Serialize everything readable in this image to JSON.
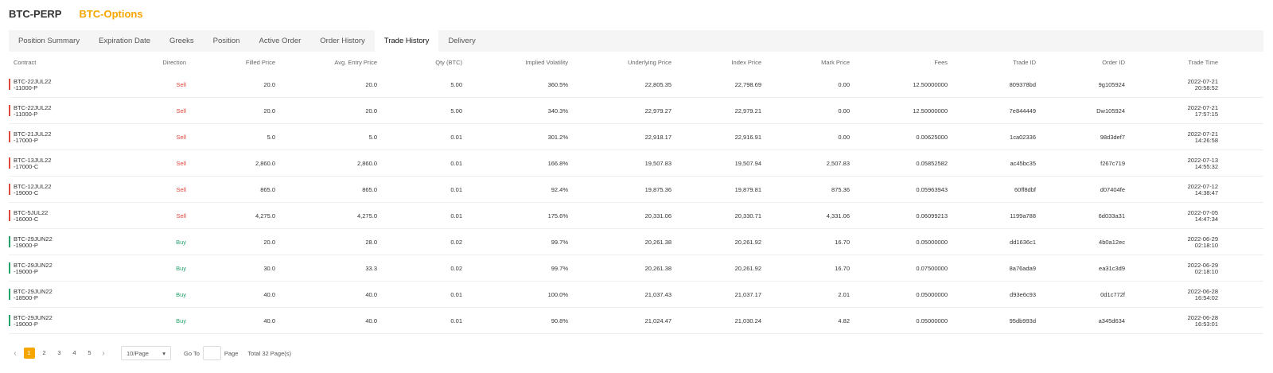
{
  "top_tabs": [
    {
      "label": "BTC-PERP",
      "active": false
    },
    {
      "label": "BTC-Options",
      "active": true
    }
  ],
  "sub_tabs": [
    {
      "label": "Position Summary",
      "active": false
    },
    {
      "label": "Expiration Date",
      "active": false
    },
    {
      "label": "Greeks",
      "active": false
    },
    {
      "label": "Position",
      "active": false
    },
    {
      "label": "Active Order",
      "active": false
    },
    {
      "label": "Order History",
      "active": false
    },
    {
      "label": "Trade History",
      "active": true
    },
    {
      "label": "Delivery",
      "active": false
    }
  ],
  "columns": [
    "Contract",
    "Direction",
    "Filled Price",
    "Avg. Entry Price",
    "Qty (BTC)",
    "Implied Volatility",
    "Underlying Price",
    "Index Price",
    "Mark Price",
    "Fees",
    "Trade ID",
    "Order ID",
    "Trade Time"
  ],
  "rows": [
    {
      "contract1": "BTC-22JUL22",
      "contract2": "-11000-P",
      "direction": "Sell",
      "filled": "20.0",
      "avg": "20.0",
      "qty": "5.00",
      "iv": "360.5%",
      "underlying": "22,805.35",
      "index": "22,798.69",
      "mark": "0.00",
      "fees": "12.50000000",
      "trade_id": "809378bd",
      "order_id": "9g105924",
      "date": "2022-07-21",
      "time": "20:58:52"
    },
    {
      "contract1": "BTC-22JUL22",
      "contract2": "-11000-P",
      "direction": "Sell",
      "filled": "20.0",
      "avg": "20.0",
      "qty": "5.00",
      "iv": "340.3%",
      "underlying": "22,979.27",
      "index": "22,979.21",
      "mark": "0.00",
      "fees": "12.50000000",
      "trade_id": "7e844449",
      "order_id": "Dw105924",
      "date": "2022-07-21",
      "time": "17:57:15"
    },
    {
      "contract1": "BTC-21JUL22",
      "contract2": "-17000-P",
      "direction": "Sell",
      "filled": "5.0",
      "avg": "5.0",
      "qty": "0.01",
      "iv": "301.2%",
      "underlying": "22,918.17",
      "index": "22,916.91",
      "mark": "0.00",
      "fees": "0.00625000",
      "trade_id": "1ca02336",
      "order_id": "98d3def7",
      "date": "2022-07-21",
      "time": "14:26:58"
    },
    {
      "contract1": "BTC-13JUL22",
      "contract2": "-17000-C",
      "direction": "Sell",
      "filled": "2,860.0",
      "avg": "2,860.0",
      "qty": "0.01",
      "iv": "166.8%",
      "underlying": "19,507.83",
      "index": "19,507.94",
      "mark": "2,507.83",
      "fees": "0.05852582",
      "trade_id": "ac45bc35",
      "order_id": "f267c719",
      "date": "2022-07-13",
      "time": "14:55:32"
    },
    {
      "contract1": "BTC-12JUL22",
      "contract2": "-19000-C",
      "direction": "Sell",
      "filled": "865.0",
      "avg": "865.0",
      "qty": "0.01",
      "iv": "92.4%",
      "underlying": "19,875.36",
      "index": "19,879.81",
      "mark": "875.36",
      "fees": "0.05963943",
      "trade_id": "60ff8dbf",
      "order_id": "d07404fe",
      "date": "2022-07-12",
      "time": "14:38:47"
    },
    {
      "contract1": "BTC-5JUL22",
      "contract2": "-16000-C",
      "direction": "Sell",
      "filled": "4,275.0",
      "avg": "4,275.0",
      "qty": "0.01",
      "iv": "175.6%",
      "underlying": "20,331.06",
      "index": "20,330.71",
      "mark": "4,331.06",
      "fees": "0.06099213",
      "trade_id": "1199a788",
      "order_id": "6d033a31",
      "date": "2022-07-05",
      "time": "14:47:34"
    },
    {
      "contract1": "BTC-29JUN22",
      "contract2": "-19000-P",
      "direction": "Buy",
      "filled": "20.0",
      "avg": "28.0",
      "qty": "0.02",
      "iv": "99.7%",
      "underlying": "20,261.38",
      "index": "20,261.92",
      "mark": "16.70",
      "fees": "0.05000000",
      "trade_id": "dd1636c1",
      "order_id": "4b0a12ec",
      "date": "2022-06-29",
      "time": "02:18:10"
    },
    {
      "contract1": "BTC-29JUN22",
      "contract2": "-19000-P",
      "direction": "Buy",
      "filled": "30.0",
      "avg": "33.3",
      "qty": "0.02",
      "iv": "99.7%",
      "underlying": "20,261.38",
      "index": "20,261.92",
      "mark": "16.70",
      "fees": "0.07500000",
      "trade_id": "8a76ada9",
      "order_id": "ea31c3d9",
      "date": "2022-06-29",
      "time": "02:18:10"
    },
    {
      "contract1": "BTC-29JUN22",
      "contract2": "-18500-P",
      "direction": "Buy",
      "filled": "40.0",
      "avg": "40.0",
      "qty": "0.01",
      "iv": "100.0%",
      "underlying": "21,037.43",
      "index": "21,037.17",
      "mark": "2.01",
      "fees": "0.05000000",
      "trade_id": "d93e6c93",
      "order_id": "0d1c772f",
      "date": "2022-06-28",
      "time": "16:54:02"
    },
    {
      "contract1": "BTC-29JUN22",
      "contract2": "-19000-P",
      "direction": "Buy",
      "filled": "40.0",
      "avg": "40.0",
      "qty": "0.01",
      "iv": "90.8%",
      "underlying": "21,024.47",
      "index": "21,030.24",
      "mark": "4.82",
      "fees": "0.05000000",
      "trade_id": "95db993d",
      "order_id": "a345d634",
      "date": "2022-06-28",
      "time": "16:53:01"
    }
  ],
  "pagination": {
    "prev": "‹",
    "next": "›",
    "pages": [
      "1",
      "2",
      "3",
      "4",
      "5"
    ],
    "current_page": "1",
    "page_size": "10/Page",
    "dropdown": "▾",
    "goto_label": "Go To",
    "page_label": "Page",
    "total": "Total 32 Page(s)"
  },
  "colors": {
    "accent": "#f7a600",
    "sell": "#e0483d",
    "buy": "#24a36b"
  }
}
